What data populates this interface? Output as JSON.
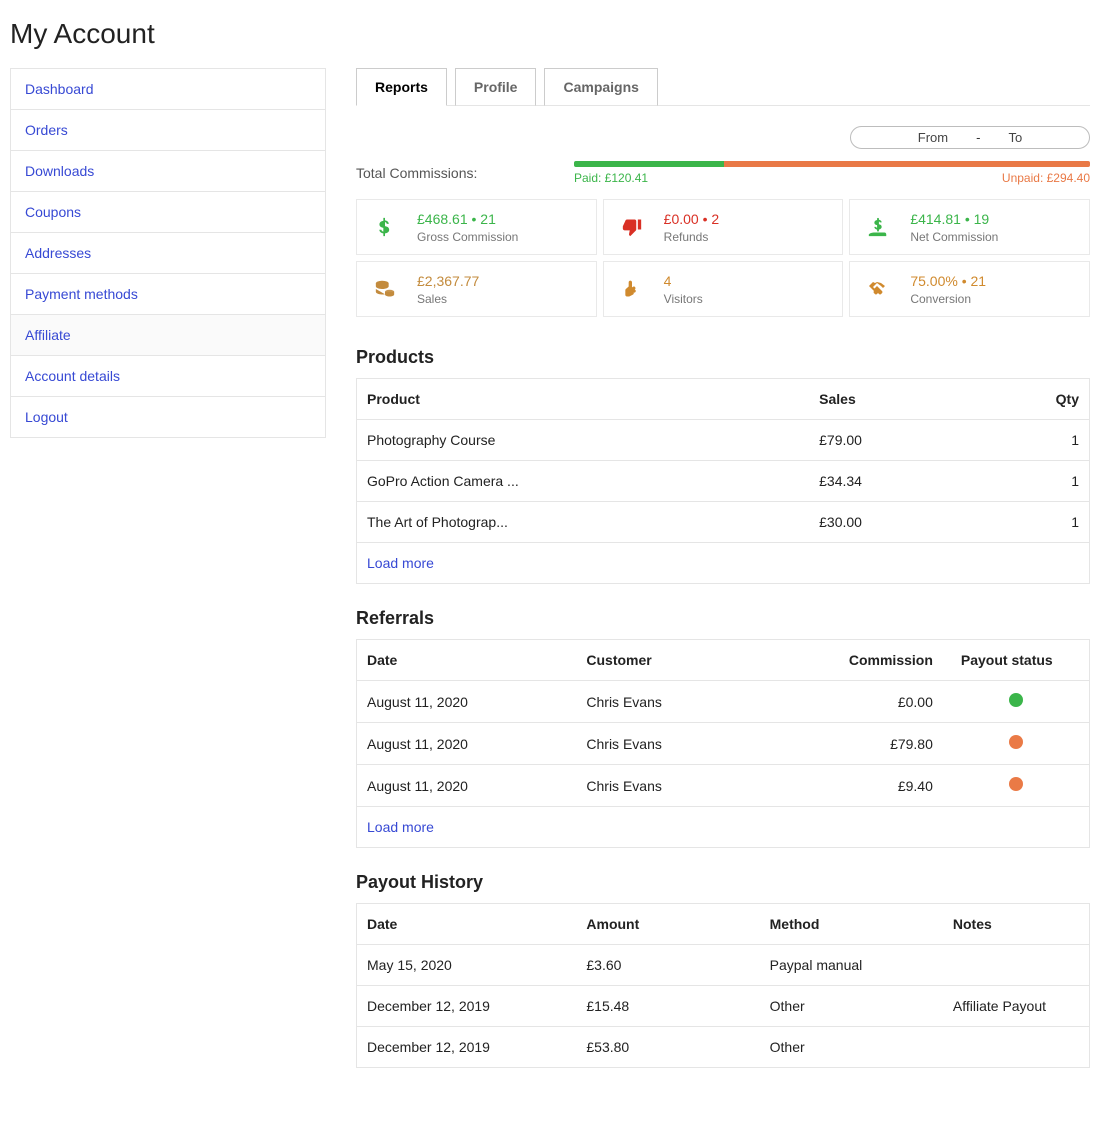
{
  "page_title": "My Account",
  "sidebar": {
    "items": [
      {
        "label": "Dashboard",
        "active": false
      },
      {
        "label": "Orders",
        "active": false
      },
      {
        "label": "Downloads",
        "active": false
      },
      {
        "label": "Coupons",
        "active": false
      },
      {
        "label": "Addresses",
        "active": false
      },
      {
        "label": "Payment methods",
        "active": false
      },
      {
        "label": "Affiliate",
        "active": true
      },
      {
        "label": "Account details",
        "active": false
      },
      {
        "label": "Logout",
        "active": false
      }
    ]
  },
  "tabs": [
    {
      "label": "Reports",
      "active": true
    },
    {
      "label": "Profile",
      "active": false
    },
    {
      "label": "Campaigns",
      "active": false
    }
  ],
  "date_filter": {
    "from_label": "From",
    "sep": "-",
    "to_label": "To"
  },
  "commissions": {
    "label": "Total Commissions:",
    "paid_label": "Paid: £120.41",
    "unpaid_label": "Unpaid: £294.40",
    "paid_pct": 29
  },
  "stats": {
    "gross": {
      "value": "£468.61 • 21",
      "label": "Gross Commission",
      "icon": "dollar-sign-icon",
      "colorClass": "c-green"
    },
    "refunds": {
      "value": "£0.00 • 2",
      "label": "Refunds",
      "icon": "thumbs-down-icon",
      "colorClass": "c-red"
    },
    "net": {
      "value": "£414.81 • 19",
      "label": "Net Commission",
      "icon": "hand-money-icon",
      "colorClass": "c-green"
    },
    "sales": {
      "value": "£2,367.77",
      "label": "Sales",
      "icon": "coins-icon",
      "colorClass": "c-brown"
    },
    "visitors": {
      "value": "4",
      "label": "Visitors",
      "icon": "hand-pointer-icon",
      "colorClass": "c-orange"
    },
    "conversion": {
      "value": "75.00% • 21",
      "label": "Conversion",
      "icon": "handshake-icon",
      "colorClass": "c-orange"
    }
  },
  "products": {
    "title": "Products",
    "headers": {
      "product": "Product",
      "sales": "Sales",
      "qty": "Qty"
    },
    "rows": [
      {
        "product": "Photography Course",
        "sales": "£79.00",
        "qty": "1"
      },
      {
        "product": "GoPro Action Camera ...",
        "sales": "£34.34",
        "qty": "1"
      },
      {
        "product": "The Art of Photograp...",
        "sales": "£30.00",
        "qty": "1"
      }
    ],
    "load_more": "Load more"
  },
  "referrals": {
    "title": "Referrals",
    "headers": {
      "date": "Date",
      "customer": "Customer",
      "commission": "Commission",
      "status": "Payout status"
    },
    "rows": [
      {
        "date": "August 11, 2020",
        "customer": "Chris Evans",
        "commission": "£0.00",
        "status": "green"
      },
      {
        "date": "August 11, 2020",
        "customer": "Chris Evans",
        "commission": "£79.80",
        "status": "orange"
      },
      {
        "date": "August 11, 2020",
        "customer": "Chris Evans",
        "commission": "£9.40",
        "status": "orange"
      }
    ],
    "load_more": "Load more"
  },
  "payouts": {
    "title": "Payout History",
    "headers": {
      "date": "Date",
      "amount": "Amount",
      "method": "Method",
      "notes": "Notes"
    },
    "rows": [
      {
        "date": "May 15, 2020",
        "amount": "£3.60",
        "method": "Paypal manual",
        "notes": ""
      },
      {
        "date": "December 12, 2019",
        "amount": "£15.48",
        "method": "Other",
        "notes": "Affiliate Payout"
      },
      {
        "date": "December 12, 2019",
        "amount": "£53.80",
        "method": "Other",
        "notes": ""
      }
    ]
  }
}
